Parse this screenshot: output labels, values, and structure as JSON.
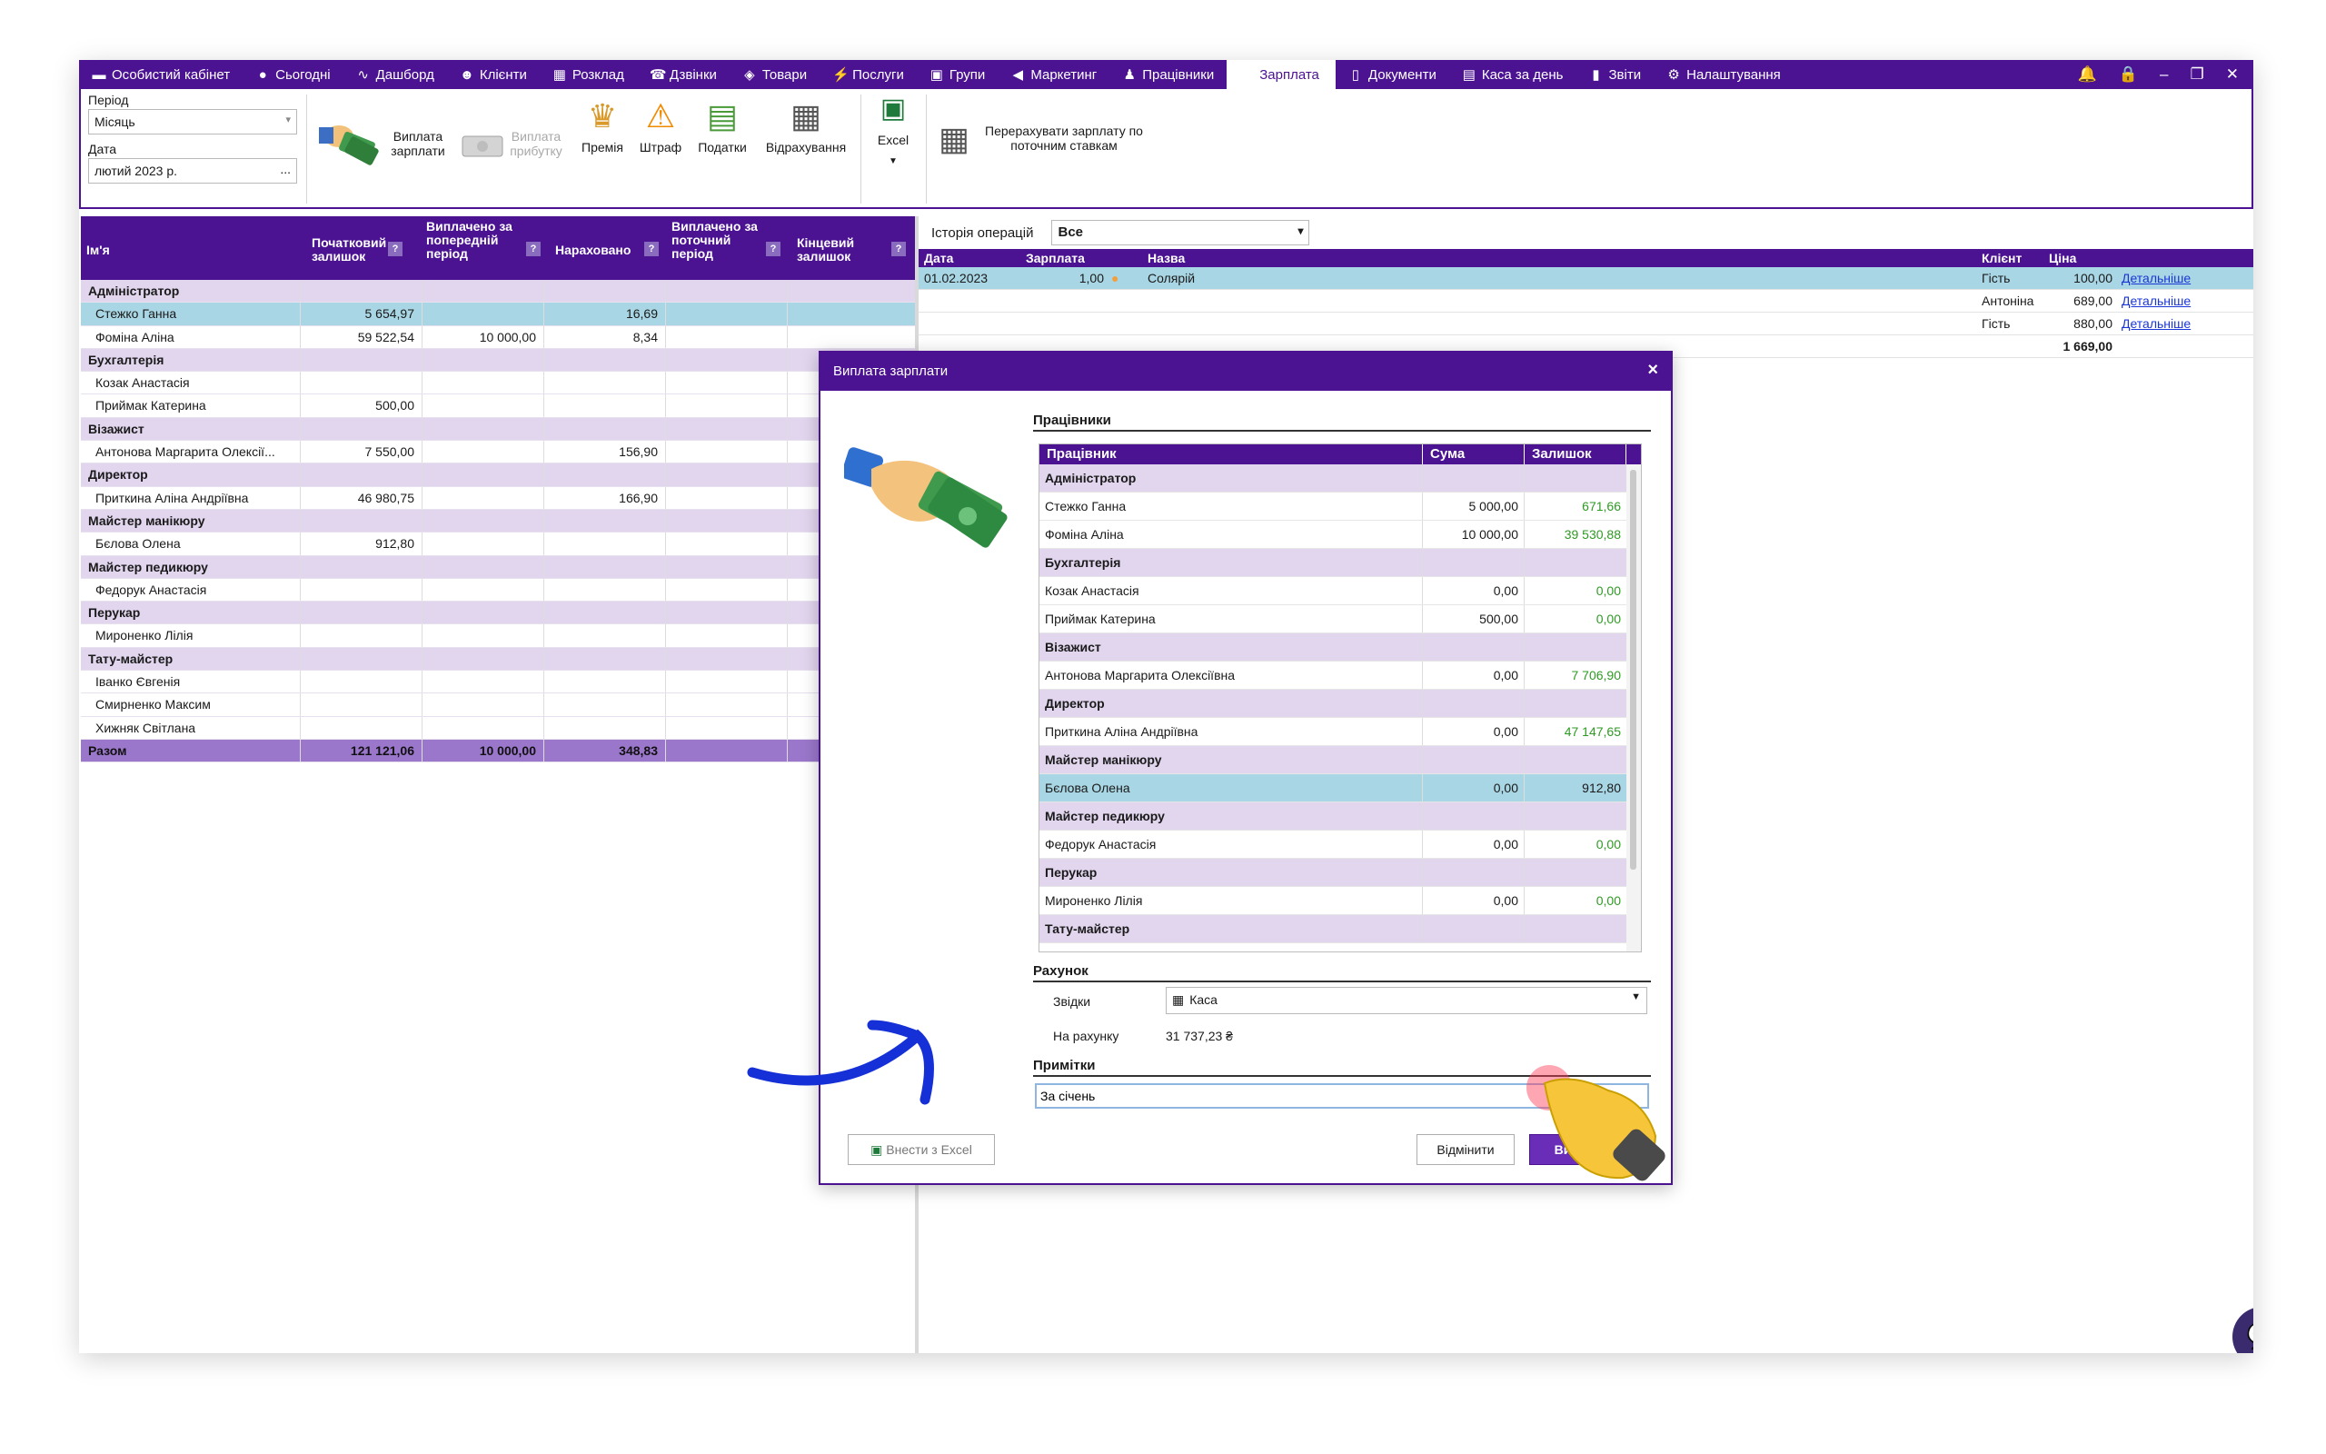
{
  "nav": {
    "tabs": [
      {
        "label": "Особистий кабінет",
        "icon": "wallet-icon",
        "glyph": "▬"
      },
      {
        "label": "Сьогодні",
        "icon": "clock-icon",
        "glyph": "●"
      },
      {
        "label": "Дашборд",
        "icon": "pulse-icon",
        "glyph": "∿"
      },
      {
        "label": "Клієнти",
        "icon": "user-circle-icon",
        "glyph": "☻"
      },
      {
        "label": "Розклад",
        "icon": "calendar-icon",
        "glyph": "▦"
      },
      {
        "label": "Дзвінки",
        "icon": "phone-icon",
        "glyph": "☎"
      },
      {
        "label": "Товари",
        "icon": "cube-icon",
        "glyph": "◈"
      },
      {
        "label": "Послуги",
        "icon": "bolt-icon",
        "glyph": "⚡"
      },
      {
        "label": "Групи",
        "icon": "group-icon",
        "glyph": "▣"
      },
      {
        "label": "Маркетинг",
        "icon": "megaphone-icon",
        "glyph": "◀"
      },
      {
        "label": "Працівники",
        "icon": "person-icon",
        "glyph": "♟"
      },
      {
        "label": "Зарплата",
        "icon": "",
        "glyph": ""
      },
      {
        "label": "Документи",
        "icon": "document-icon",
        "glyph": "▯"
      },
      {
        "label": "Каса за день",
        "icon": "calculator-icon",
        "glyph": "▤"
      },
      {
        "label": "Звіти",
        "icon": "bar-chart-icon",
        "glyph": "▮"
      },
      {
        "label": "Налаштування",
        "icon": "gear-icon",
        "glyph": "⚙"
      }
    ],
    "active_index": 11
  },
  "ribbon": {
    "period_label": "Період",
    "period_value": "Місяць",
    "date_label": "Дата",
    "date_value": "лютий 2023 р.",
    "date_button": "...",
    "pay_salary": "Виплата зарплати",
    "pay_profit": "Виплата прибутку",
    "bonus": "Премія",
    "fine": "Штраф",
    "taxes": "Податки",
    "deductions": "Відрахування",
    "excel": "Excel",
    "recalc": "Перерахувати зарплату по поточним ставкам"
  },
  "left_table": {
    "headers": [
      "Ім'я",
      "Початковий залишок",
      "Виплачено за попередній період",
      "Нараховано",
      "Виплачено за поточний період",
      "Кінцевий залишок"
    ],
    "rows": [
      {
        "type": "group",
        "name": "Адміністратор"
      },
      {
        "type": "row",
        "name": "Стежко Ганна",
        "v": [
          "5 654,97",
          "",
          "16,69",
          "",
          ""
        ],
        "selected": true
      },
      {
        "type": "row",
        "name": "Фоміна Аліна",
        "v": [
          "59 522,54",
          "10 000,00",
          "8,34",
          "",
          ""
        ]
      },
      {
        "type": "group",
        "name": "Бухгалтерія"
      },
      {
        "type": "row",
        "name": "Козак Анастасія",
        "v": [
          "",
          "",
          "",
          "",
          ""
        ]
      },
      {
        "type": "row",
        "name": "Приймак Катерина",
        "v": [
          "500,00",
          "",
          "",
          "",
          ""
        ]
      },
      {
        "type": "group",
        "name": "Візажист"
      },
      {
        "type": "row",
        "name": "Антонова Маргарита Олексії...",
        "v": [
          "7 550,00",
          "",
          "156,90",
          "",
          ""
        ]
      },
      {
        "type": "group",
        "name": "Директор"
      },
      {
        "type": "row",
        "name": "Приткина Аліна Андріївна",
        "v": [
          "46 980,75",
          "",
          "166,90",
          "",
          ""
        ]
      },
      {
        "type": "group",
        "name": "Майстер манікюру"
      },
      {
        "type": "row",
        "name": "Бєлова Олена",
        "v": [
          "912,80",
          "",
          "",
          "",
          ""
        ]
      },
      {
        "type": "group",
        "name": "Майстер педикюру"
      },
      {
        "type": "row",
        "name": "Федорук Анастасія",
        "v": [
          "",
          "",
          "",
          "",
          ""
        ]
      },
      {
        "type": "group",
        "name": "Перукар"
      },
      {
        "type": "row",
        "name": "Мироненко Лілія",
        "v": [
          "",
          "",
          "",
          "",
          ""
        ]
      },
      {
        "type": "group",
        "name": "Тату-майстер"
      },
      {
        "type": "row",
        "name": "Іванко Євгенія",
        "v": [
          "",
          "",
          "",
          "",
          ""
        ]
      },
      {
        "type": "row",
        "name": "Смирненко Максим",
        "v": [
          "",
          "",
          "",
          "",
          ""
        ]
      },
      {
        "type": "row",
        "name": "Хижняк Світлана",
        "v": [
          "",
          "",
          "",
          "",
          ""
        ]
      },
      {
        "type": "total",
        "name": "Разом",
        "v": [
          "121 121,06",
          "10 000,00",
          "348,83",
          "",
          ""
        ]
      }
    ]
  },
  "right_panel": {
    "history_label": "Історія операцій",
    "history_value": "Все",
    "headers": {
      "date": "Дата",
      "salary": "Зарплата",
      "name": "Назва",
      "client": "Клієнт",
      "price": "Ціна"
    },
    "rows": [
      {
        "date": "01.02.2023",
        "salary": "1,00",
        "name": "Солярій",
        "client": "Гість",
        "price": "100,00",
        "link": "Детальніше"
      },
      {
        "date": "",
        "salary": "",
        "name": "",
        "client": "Антоніна",
        "price": "689,00",
        "link": "Детальніше"
      },
      {
        "date": "",
        "salary": "",
        "name": "",
        "client": "Гість",
        "price": "880,00",
        "link": "Детальніше"
      }
    ],
    "total": "1 669,00"
  },
  "dialog": {
    "title": "Виплата зарплати",
    "close": "×",
    "employees_section": "Працівники",
    "headers": [
      "Працівник",
      "Сума",
      "Залишок"
    ],
    "rows": [
      {
        "type": "group",
        "name": "Адміністратор"
      },
      {
        "type": "row",
        "name": "Стежко Ганна",
        "sum": "5 000,00",
        "rest": "671,66"
      },
      {
        "type": "row",
        "name": "Фоміна Аліна",
        "sum": "10 000,00",
        "rest": "39 530,88"
      },
      {
        "type": "group",
        "name": "Бухгалтерія"
      },
      {
        "type": "row",
        "name": "Козак Анастасія",
        "sum": "0,00",
        "rest": "0,00"
      },
      {
        "type": "row",
        "name": "Приймак Катерина",
        "sum": "500,00",
        "rest": "0,00"
      },
      {
        "type": "group",
        "name": "Візажист"
      },
      {
        "type": "row",
        "name": "Антонова Маргарита Олексіївна",
        "sum": "0,00",
        "rest": "7 706,90"
      },
      {
        "type": "group",
        "name": "Директор"
      },
      {
        "type": "row",
        "name": "Приткина Аліна Андріївна",
        "sum": "0,00",
        "rest": "47 147,65"
      },
      {
        "type": "group",
        "name": "Майстер манікюру"
      },
      {
        "type": "row",
        "name": "Бєлова Олена",
        "sum": "0,00",
        "rest": "912,80",
        "selected": true
      },
      {
        "type": "group",
        "name": "Майстер педикюру"
      },
      {
        "type": "row",
        "name": "Федорук Анастасія",
        "sum": "0,00",
        "rest": "0,00"
      },
      {
        "type": "group",
        "name": "Перукар"
      },
      {
        "type": "row",
        "name": "Мироненко Лілія",
        "sum": "0,00",
        "rest": "0,00"
      },
      {
        "type": "group",
        "name": "Тату-майстер"
      }
    ],
    "account_section": "Рахунок",
    "from_label": "Звідки",
    "from_value": "Каса",
    "balance_label": "На рахунку",
    "balance_value": "31 737,23 ₴",
    "notes_section": "Примітки",
    "notes_value": "За січень",
    "import_excel": "Внести з Excel",
    "cancel": "Відмінити",
    "pay": "Виплатити"
  },
  "colors": {
    "brand": "#4b1291",
    "group_row": "#e2d6ef",
    "selected_row": "#a9d6e4",
    "positive": "#2e9a23",
    "arrow": "#1530d6"
  }
}
